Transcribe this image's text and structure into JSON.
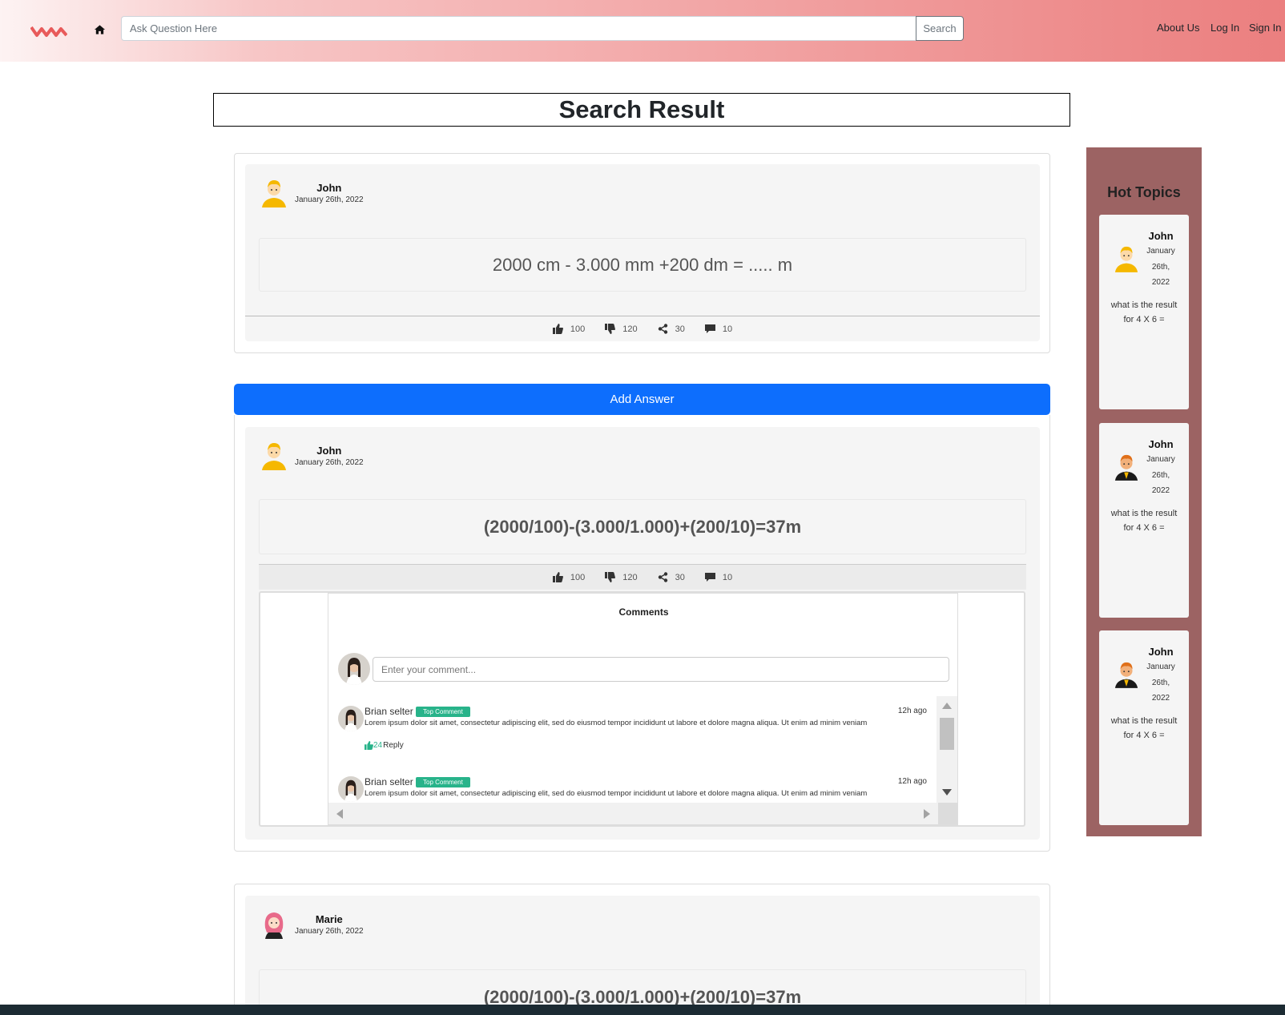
{
  "nav": {
    "search_placeholder": "Ask Question Here",
    "search_label": "Search",
    "links": [
      "About Us",
      "Log In",
      "Sign In"
    ]
  },
  "page_title": "Search Result",
  "question": {
    "author": "John",
    "date": "January 26th, 2022",
    "text": "2000 cm - 3.000 mm +200 dm = ..... m",
    "likes": "100",
    "dislikes": "120",
    "shares": "30",
    "comments": "10"
  },
  "add_answer_label": "Add Answer",
  "answers": [
    {
      "author": "John",
      "date": "January 26th, 2022",
      "text": "(2000/100)-(3.000/1.000)+(200/10)=37m",
      "likes": "100",
      "dislikes": "120",
      "shares": "30",
      "comments": "10"
    },
    {
      "author": "Marie",
      "date": "January 26th, 2022",
      "text": "(2000/100)-(3.000/1.000)+(200/10)=37m"
    }
  ],
  "comments_section": {
    "title": "Comments",
    "input_placeholder": "Enter your comment...",
    "items": [
      {
        "name": "Brian selter",
        "badge": "Top Comment",
        "time": "12h ago",
        "text": "Lorem ipsum dolor sit amet, consectetur adipiscing elit, sed do eiusmod tempor incididunt ut labore et dolore magna aliqua. Ut enim ad minim veniam",
        "likes": "24",
        "reply_label": "Reply"
      },
      {
        "name": "Brian selter",
        "badge": "Top Comment",
        "time": "12h ago",
        "text": "Lorem ipsum dolor sit amet, consectetur adipiscing elit, sed do eiusmod tempor incididunt ut labore et dolore magna aliqua. Ut enim ad minim veniam"
      }
    ]
  },
  "hot_topics": {
    "title": "Hot Topics",
    "items": [
      {
        "author": "John",
        "date_lines": [
          "January",
          "26th,",
          "2022"
        ],
        "text": "what is the result for 4 X 6 ="
      },
      {
        "author": "John",
        "date_lines": [
          "January",
          "26th,",
          "2022"
        ],
        "text": "what is the result for 4 X 6 ="
      },
      {
        "author": "John",
        "date_lines": [
          "January",
          "26th,",
          "2022"
        ],
        "text": "what is the result for 4 X 6 ="
      }
    ]
  },
  "colors": {
    "accent_blue": "#0d6efd",
    "sidebar_bg": "#9c6363",
    "badge_green": "#28b38a"
  }
}
